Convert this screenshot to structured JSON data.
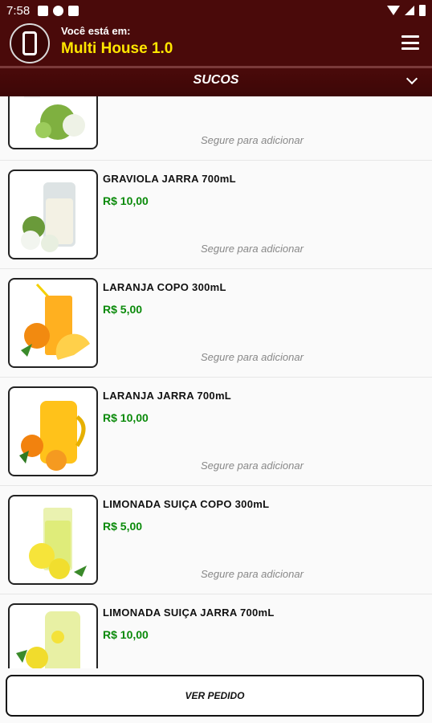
{
  "status_bar": {
    "time": "7:58"
  },
  "header": {
    "subtitle": "Você está em:",
    "title": "Multi House 1.0"
  },
  "category": {
    "label": "SUCOS"
  },
  "products": [
    {
      "name": "GRAVIOLA JARRA 700mL",
      "price": "R$ 10,00",
      "hint": "Segure para adicionar",
      "image": "graviola-jarra"
    },
    {
      "name": "LARANJA COPO 300mL",
      "price": "R$ 5,00",
      "hint": "Segure para adicionar",
      "image": "laranja-copo"
    },
    {
      "name": "LARANJA JARRA 700mL",
      "price": "R$ 10,00",
      "hint": "Segure para adicionar",
      "image": "laranja-jarra"
    },
    {
      "name": "LIMONADA SUIÇA COPO 300mL",
      "price": "R$ 5,00",
      "hint": "Segure para adicionar",
      "image": "limonada-copo"
    },
    {
      "name": "LIMONADA SUIÇA JARRA 700mL",
      "price": "R$ 10,00",
      "hint": "",
      "image": "limonada-jarra"
    }
  ],
  "first_item_hint": "Segure para adicionar",
  "footer": {
    "button_label": "VER PEDIDO"
  },
  "colors": {
    "brand": "#4a0a0a",
    "title": "#ffe600",
    "price": "#0a8a0a"
  }
}
